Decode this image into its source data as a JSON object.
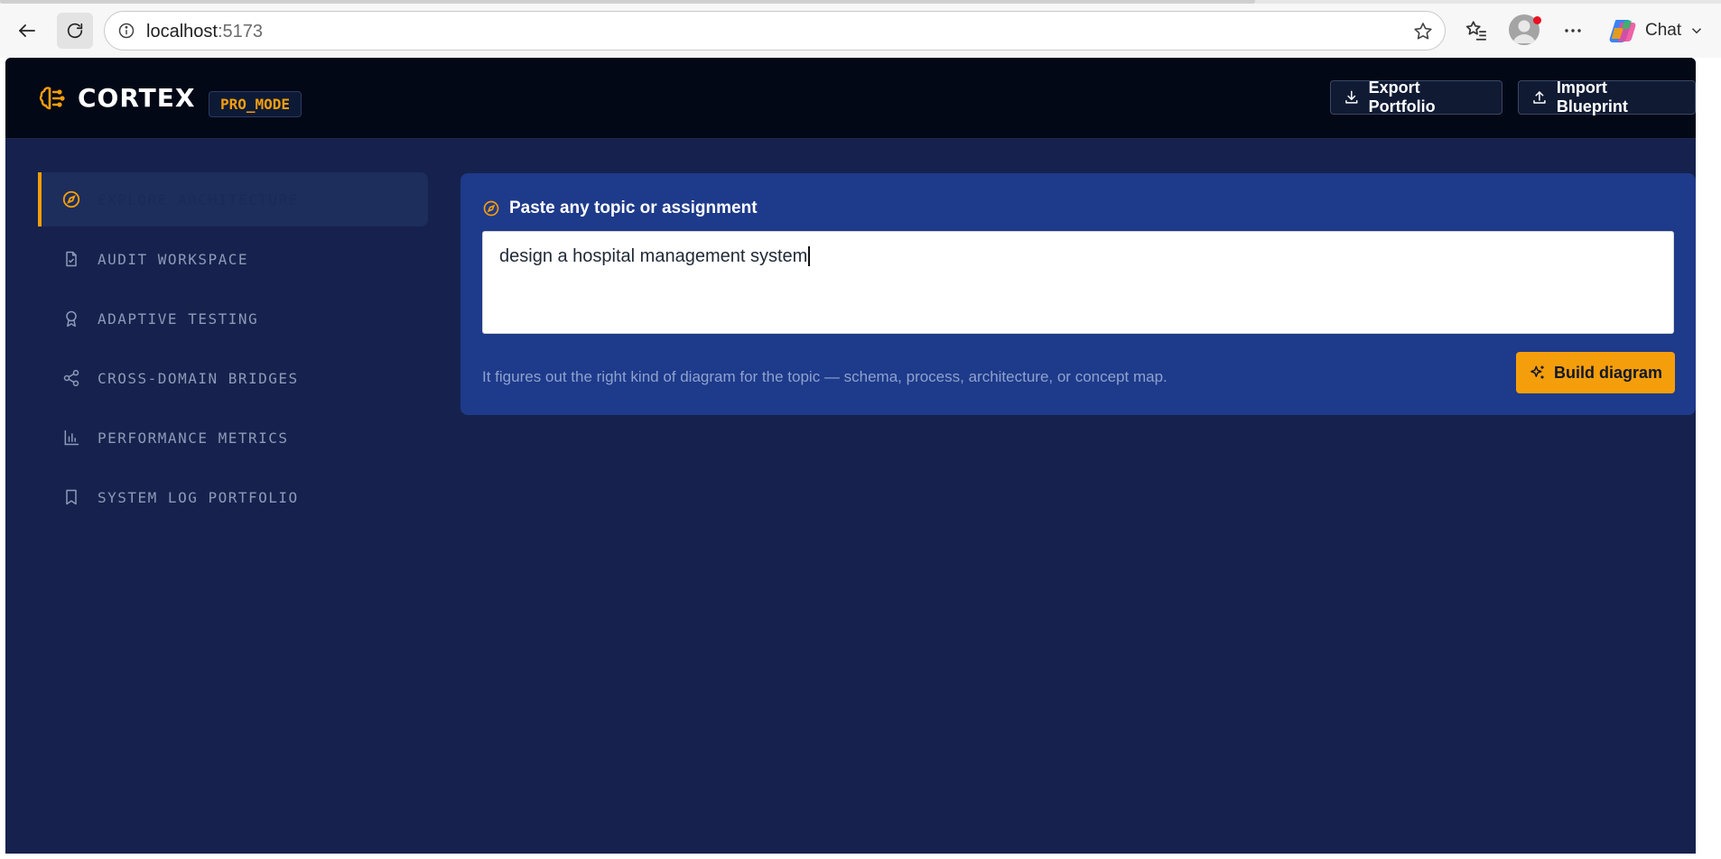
{
  "browser": {
    "url_host": "localhost",
    "url_port": ":5173",
    "chat_label": "Chat"
  },
  "app": {
    "brand": "CORTEX",
    "mode_badge": "PRO_MODE",
    "header_buttons": {
      "export": "Export Portfolio",
      "import": "Import Blueprint"
    },
    "sidebar": {
      "items": [
        {
          "label": "EXPLORE ARCHITECTURE",
          "icon": "compass-icon",
          "active": true
        },
        {
          "label": "AUDIT WORKSPACE",
          "icon": "file-check-icon",
          "active": false
        },
        {
          "label": "ADAPTIVE TESTING",
          "icon": "award-icon",
          "active": false
        },
        {
          "label": "CROSS-DOMAIN BRIDGES",
          "icon": "share-icon",
          "active": false
        },
        {
          "label": "PERFORMANCE METRICS",
          "icon": "bar-chart-icon",
          "active": false
        },
        {
          "label": "SYSTEM LOG PORTFOLIO",
          "icon": "bookmark-icon",
          "active": false
        }
      ]
    },
    "main": {
      "card_title": "Paste any topic or assignment",
      "input_value": "design a hospital management system",
      "hint": "It figures out the right kind of diagram for the topic — schema, process, architecture, or concept map.",
      "build_button": "Build diagram"
    }
  },
  "colors": {
    "accent": "#f59e0b",
    "header_bg": "#030816",
    "app_bg": "#16224d",
    "card_bg": "#1e3a8a",
    "sidebar_active_bg": "#1d2d5c"
  }
}
